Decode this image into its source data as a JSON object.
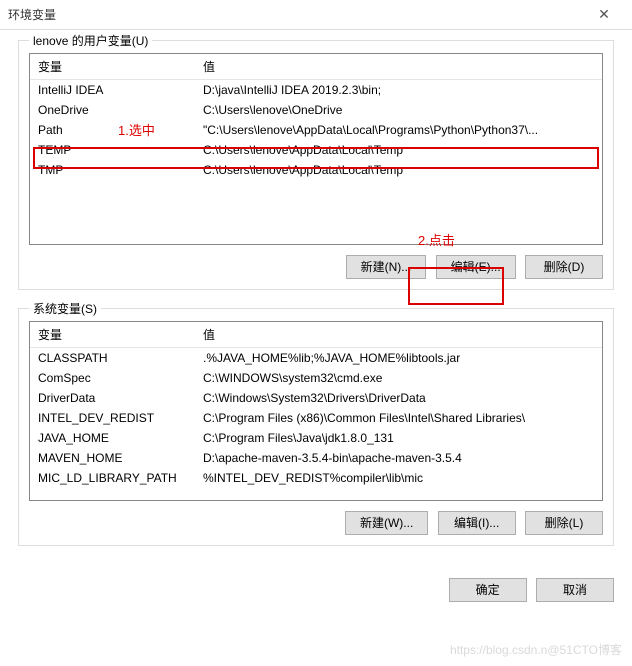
{
  "window": {
    "title": "环境变量"
  },
  "user_section": {
    "legend": "lenove 的用户变量(U)",
    "columns": {
      "var": "变量",
      "val": "值"
    },
    "rows": [
      {
        "var": "IntelliJ IDEA",
        "val": "D:\\java\\IntelliJ IDEA 2019.2.3\\bin;"
      },
      {
        "var": "OneDrive",
        "val": "C:\\Users\\lenove\\OneDrive"
      },
      {
        "var": "Path",
        "val": "\"C:\\Users\\lenove\\AppData\\Local\\Programs\\Python\\Python37\\..."
      },
      {
        "var": "TEMP",
        "val": "C:\\Users\\lenove\\AppData\\Local\\Temp"
      },
      {
        "var": "TMP",
        "val": "C:\\Users\\lenove\\AppData\\Local\\Temp"
      }
    ],
    "buttons": {
      "new": "新建(N)...",
      "edit": "编辑(E)...",
      "delete": "删除(D)"
    }
  },
  "system_section": {
    "legend": "系统变量(S)",
    "columns": {
      "var": "变量",
      "val": "值"
    },
    "rows": [
      {
        "var": "CLASSPATH",
        "val": ".%JAVA_HOME%lib;%JAVA_HOME%libtools.jar"
      },
      {
        "var": "ComSpec",
        "val": "C:\\WINDOWS\\system32\\cmd.exe"
      },
      {
        "var": "DriverData",
        "val": "C:\\Windows\\System32\\Drivers\\DriverData"
      },
      {
        "var": "INTEL_DEV_REDIST",
        "val": "C:\\Program Files (x86)\\Common Files\\Intel\\Shared Libraries\\"
      },
      {
        "var": "JAVA_HOME",
        "val": "C:\\Program Files\\Java\\jdk1.8.0_131"
      },
      {
        "var": "MAVEN_HOME",
        "val": "D:\\apache-maven-3.5.4-bin\\apache-maven-3.5.4"
      },
      {
        "var": "MIC_LD_LIBRARY_PATH",
        "val": "%INTEL_DEV_REDIST%compiler\\lib\\mic"
      }
    ],
    "buttons": {
      "new": "新建(W)...",
      "edit": "编辑(I)...",
      "delete": "删除(L)"
    }
  },
  "footer": {
    "ok": "确定",
    "cancel": "取消"
  },
  "annotations": {
    "select": "1.选中",
    "click": "2.点击"
  },
  "watermark": "https://blog.csdn.n@51CTO博客"
}
